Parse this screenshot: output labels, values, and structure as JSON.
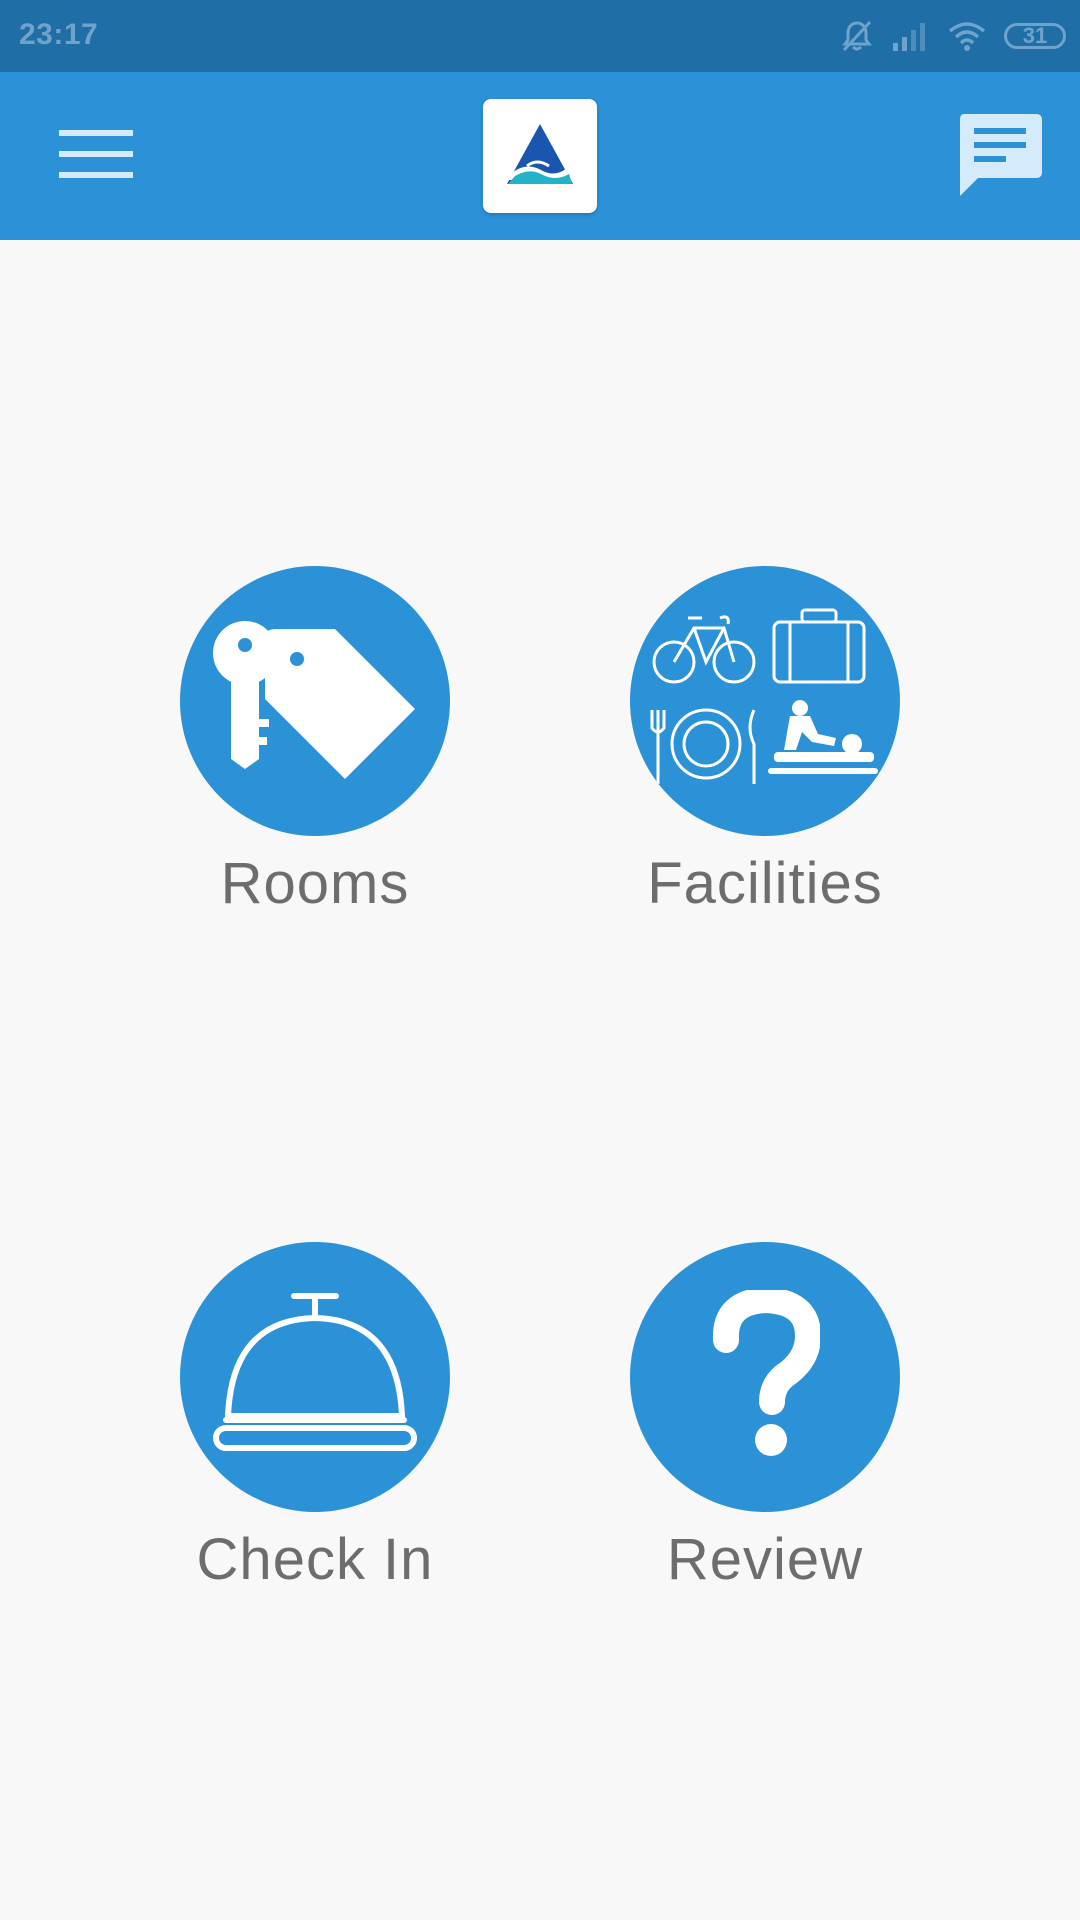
{
  "status_bar": {
    "time": "23:17",
    "battery": "31",
    "icons": [
      "notifications-off-icon",
      "signal-icon",
      "wifi-icon",
      "battery-icon"
    ]
  },
  "app_bar": {
    "background": "#2b92d8",
    "menu_icon": "hamburger-menu-icon",
    "logo_icon": "hotel-logo-icon",
    "chat_icon": "chat-icon"
  },
  "colors": {
    "status_bar": "#1f6ea6",
    "accent": "#2b92d8",
    "label_text": "#6d6d6d",
    "page_background": "#f8f8f8"
  },
  "menu_items": [
    {
      "label": "Rooms",
      "icon": "key-tag-icon"
    },
    {
      "label": "Facilities",
      "icon": "facilities-icon"
    },
    {
      "label": "Check In",
      "icon": "reception-bell-icon"
    },
    {
      "label": "Review",
      "icon": "question-mark-icon"
    }
  ]
}
